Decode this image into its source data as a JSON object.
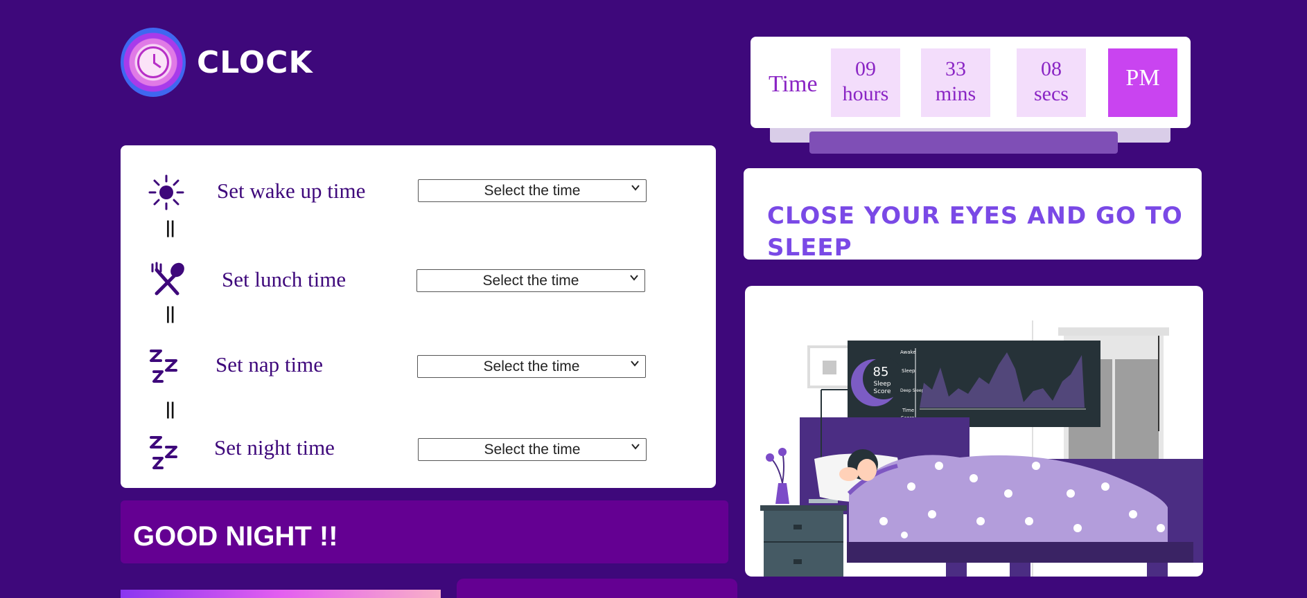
{
  "logo": {
    "text": "CLOCK",
    "icon": "clock-icon"
  },
  "clock": {
    "label": "Time",
    "hours_value": "09",
    "hours_unit": "hours",
    "mins_value": "33",
    "mins_unit": "mins",
    "secs_value": "08",
    "secs_unit": "secs",
    "ampm": "PM"
  },
  "schedule": {
    "separator": "||",
    "rows": [
      {
        "label": "Set wake up time",
        "select": "Select the time",
        "icon": "sun-icon"
      },
      {
        "label": "Set lunch time",
        "select": "Select the time",
        "icon": "fork-spoon-icon"
      },
      {
        "label": "Set nap time",
        "select": "Select the time",
        "icon": "zzz-icon"
      },
      {
        "label": "Set night time",
        "select": "Select the time",
        "icon": "zzz-icon"
      }
    ]
  },
  "message": {
    "text": "CLOSE YOUR EYES AND GO TO SLEEP"
  },
  "illustration": {
    "sleep_score": "85",
    "sleep_score_label1": "Sleep",
    "sleep_score_label2": "Score",
    "row_labels": [
      "Awake",
      "Sleep",
      "Deep Sleep",
      "Time",
      "Score"
    ]
  },
  "greeting": {
    "text": "GOOD NIGHT !!"
  },
  "colors": {
    "background": "#3e087b",
    "accent": "#c944f0",
    "panel": "#640092",
    "text_purple": "#7a49e6"
  }
}
